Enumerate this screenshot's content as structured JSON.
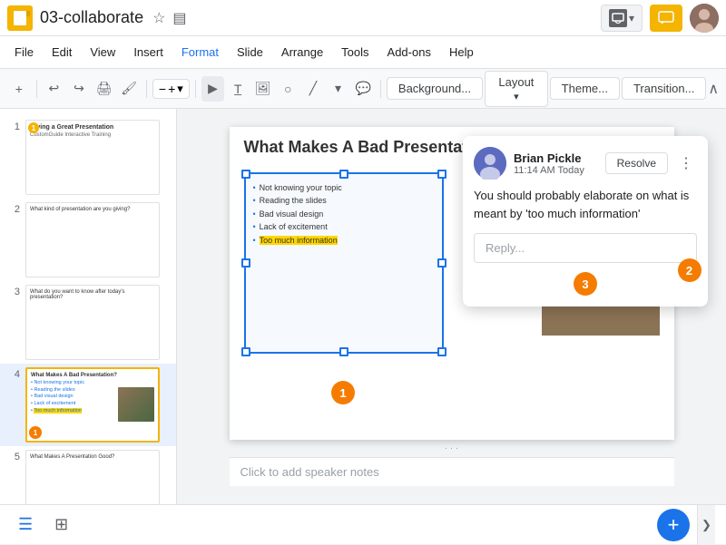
{
  "titlebar": {
    "filename": "03-collaborate",
    "logo_label": "G",
    "present_label": "Present",
    "comment_icon": "💬"
  },
  "menubar": {
    "items": [
      "File",
      "Edit",
      "View",
      "Insert",
      "Format",
      "Slide",
      "Arrange",
      "Tools",
      "Add-ons",
      "Help"
    ]
  },
  "toolbar": {
    "zoom": "⊕",
    "zoom_level": "↔",
    "background_label": "Background...",
    "layout_label": "Layout",
    "theme_label": "Theme...",
    "transition_label": "Transition..."
  },
  "slides": [
    {
      "num": "1",
      "title": "Giving a Great Presentation",
      "subtitle": "CustomGuide Interactive Training",
      "active": false
    },
    {
      "num": "2",
      "title": "What kind of presentation are you giving?",
      "subtitle": "",
      "active": false
    },
    {
      "num": "3",
      "title": "What do you want to know after today's presentation?",
      "subtitle": "",
      "active": false
    },
    {
      "num": "4",
      "title": "What Makes A Bad Presentation?",
      "subtitle": "",
      "active": true,
      "badge": "1"
    },
    {
      "num": "5",
      "title": "What Makes A Presentation Good?",
      "subtitle": "",
      "active": false
    }
  ],
  "current_slide": {
    "title": "What Makes A Bad Presentation?",
    "bullets": [
      "Not knowing your topic",
      "Reading the slides",
      "Bad visual design",
      "Lack of excitement",
      "Too much information"
    ],
    "highlight_index": 4
  },
  "comment": {
    "commenter": "Brian Pickle",
    "time": "11:14 AM Today",
    "body": "You should probably elaborate on what is meant by 'too much information'",
    "reply_placeholder": "Reply...",
    "resolve_label": "Resolve"
  },
  "speaker_notes": {
    "placeholder": "Click to add speaker notes"
  },
  "badges": {
    "num1": "1",
    "num2": "2",
    "num3": "3"
  },
  "bottom_bar": {
    "add_icon": "+",
    "toggle_icon": "❯"
  }
}
